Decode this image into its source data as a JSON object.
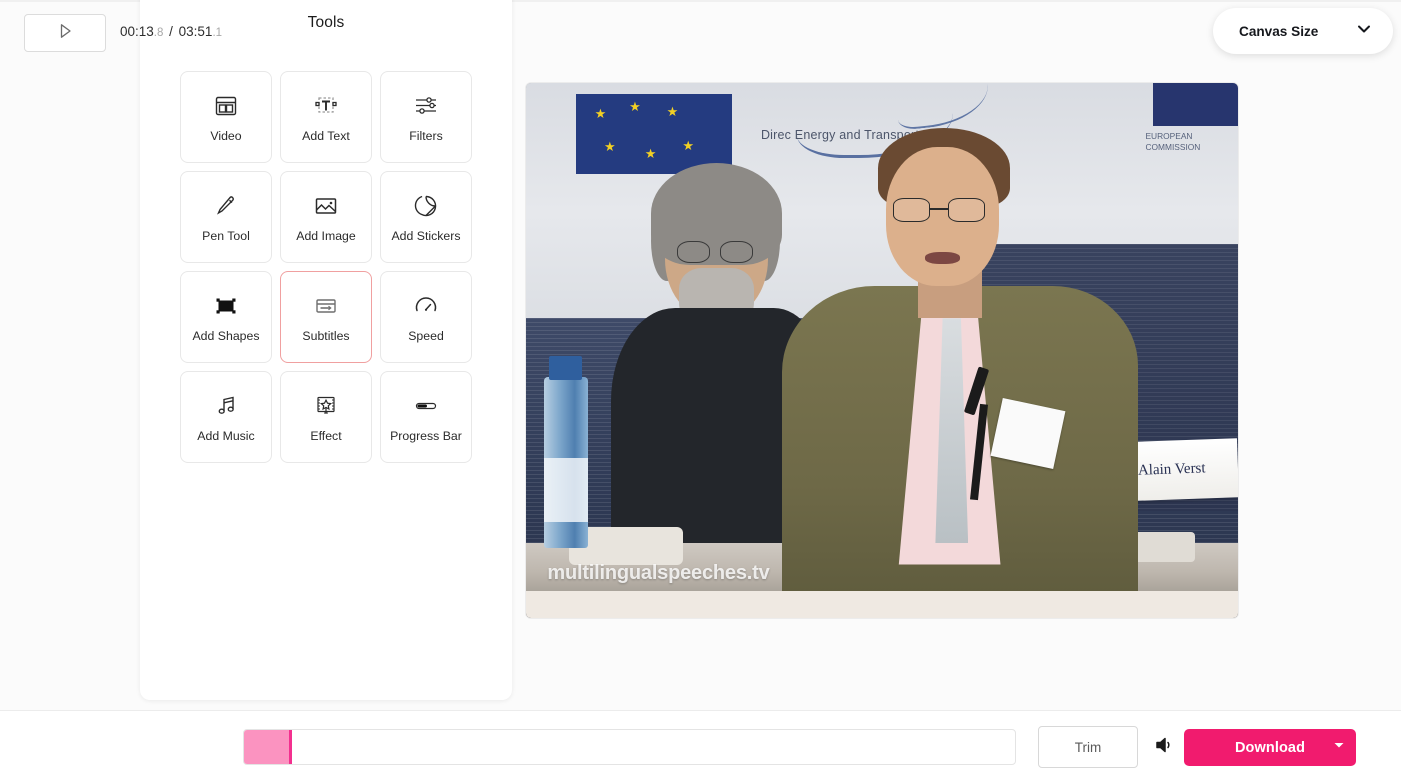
{
  "header": {
    "canvas_size_label": "Canvas Size",
    "chevron_icon": "chevron-down-icon"
  },
  "tools_panel": {
    "title": "Tools",
    "selected_tool": "Subtitles",
    "selected_border_color": "#f0a0a0",
    "items": [
      {
        "label": "Video",
        "icon": "video-layout-icon",
        "selected": false
      },
      {
        "label": "Add Text",
        "icon": "text-box-icon",
        "selected": false
      },
      {
        "label": "Filters",
        "icon": "sliders-icon",
        "selected": false
      },
      {
        "label": "Pen Tool",
        "icon": "pen-icon",
        "selected": false
      },
      {
        "label": "Add Image",
        "icon": "image-icon",
        "selected": false
      },
      {
        "label": "Add Stickers",
        "icon": "sticker-icon",
        "selected": false
      },
      {
        "label": "Add Shapes",
        "icon": "shapes-icon",
        "selected": false
      },
      {
        "label": "Subtitles",
        "icon": "subtitles-icon",
        "selected": true
      },
      {
        "label": "Speed",
        "icon": "speedometer-icon",
        "selected": false
      },
      {
        "label": "Add Music",
        "icon": "music-note-icon",
        "selected": false
      },
      {
        "label": "Effect",
        "icon": "effect-sparkle-icon",
        "selected": false
      },
      {
        "label": "Progress Bar",
        "icon": "progress-bar-icon",
        "selected": false
      }
    ]
  },
  "preview": {
    "watermark": "multilingualspeeches.tv",
    "backdrop_caption": "Direc            Energy and Transport",
    "commission_text": "EUROPEAN COMMISSION",
    "name_card": "Alain Verst"
  },
  "player": {
    "play_icon": "play-icon",
    "current_time_main": "00:13",
    "current_time_frac": ".8",
    "time_separator": " / ",
    "total_time_main": "03:51",
    "total_time_frac": ".1",
    "progress_percent": 6.0,
    "fill_color": "#fb93c0",
    "playhead_color": "#f3308f"
  },
  "actions": {
    "trim_label": "Trim",
    "volume_icon": "volume-icon",
    "download_label": "Download",
    "download_color": "#f11b6e",
    "download_caret_icon": "caret-down-icon"
  }
}
